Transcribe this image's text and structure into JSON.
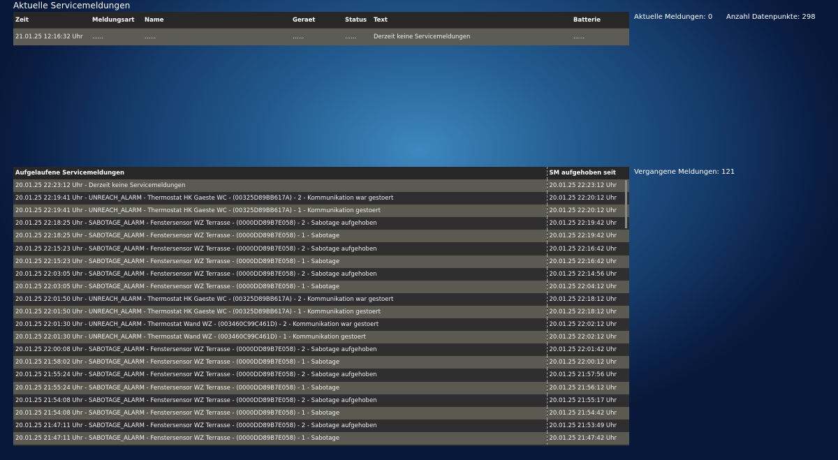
{
  "page_title": "Aktuelle Servicemeldungen",
  "current": {
    "headers": [
      "Zeit",
      "Meldungsart",
      "Name",
      "Geraet",
      "Status",
      "Text",
      "Batterie"
    ],
    "row": [
      "21.01.25 12:16:32 Uhr",
      "......",
      "......",
      "......",
      "......",
      "Derzeit keine Servicemeldungen",
      "......"
    ]
  },
  "info": {
    "current_count": "Aktuelle Meldungen: 0",
    "datapoints": "Anzahl Datenpunkte: 298",
    "past_count": "Vergangene Meldungen: 121"
  },
  "past": {
    "headers": [
      "Aufgelaufene Servicemeldungen",
      "SM aufgehoben seit"
    ],
    "rows": [
      [
        "20.01.25 22:23:12 Uhr - Derzeit keine Servicemeldungen",
        "20.01.25 22:23:12 Uhr"
      ],
      [
        "20.01.25 22:19:41 Uhr - UNREACH_ALARM - Thermostat HK Gaeste WC - (00325D89BB617A) - 2 - Kommunikation war gestoert",
        "20.01.25 22:20:12 Uhr"
      ],
      [
        "20.01.25 22:19:41 Uhr - UNREACH_ALARM - Thermostat HK Gaeste WC - (00325D89BB617A) - 1 - Kommunikation gestoert",
        "20.01.25 22:20:12 Uhr"
      ],
      [
        "20.01.25 22:18:25 Uhr - SABOTAGE_ALARM - Fenstersensor WZ Terrasse - (0000DD89B7E058) - 2 - Sabotage aufgehoben",
        "20.01.25 22:19:42 Uhr"
      ],
      [
        "20.01.25 22:18:25 Uhr - SABOTAGE_ALARM - Fenstersensor WZ Terrasse - (0000DD89B7E058) - 1 - Sabotage",
        "20.01.25 22:19:42 Uhr"
      ],
      [
        "20.01.25 22:15:23 Uhr - SABOTAGE_ALARM - Fenstersensor WZ Terrasse - (0000DD89B7E058) - 2 - Sabotage aufgehoben",
        "20.01.25 22:16:42 Uhr"
      ],
      [
        "20.01.25 22:15:23 Uhr - SABOTAGE_ALARM - Fenstersensor WZ Terrasse - (0000DD89B7E058) - 1 - Sabotage",
        "20.01.25 22:16:42 Uhr"
      ],
      [
        "20.01.25 22:03:05 Uhr - SABOTAGE_ALARM - Fenstersensor WZ Terrasse - (0000DD89B7E058) - 2 - Sabotage aufgehoben",
        "20.01.25 22:14:56 Uhr"
      ],
      [
        "20.01.25 22:03:05 Uhr - SABOTAGE_ALARM - Fenstersensor WZ Terrasse - (0000DD89B7E058) - 1 - Sabotage",
        "20.01.25 22:04:12 Uhr"
      ],
      [
        "20.01.25 22:01:50 Uhr - UNREACH_ALARM - Thermostat HK Gaeste WC - (00325D89BB617A) - 2 - Kommunikation war gestoert",
        "20.01.25 22:18:12 Uhr"
      ],
      [
        "20.01.25 22:01:50 Uhr - UNREACH_ALARM - Thermostat HK Gaeste WC - (00325D89BB617A) - 1 - Kommunikation gestoert",
        "20.01.25 22:18:12 Uhr"
      ],
      [
        "20.01.25 22:01:30 Uhr - UNREACH_ALARM - Thermostat Wand WZ - (003460C99C461D) - 2 - Kommunikation war gestoert",
        "20.01.25 22:02:12 Uhr"
      ],
      [
        "20.01.25 22:01:30 Uhr - UNREACH_ALARM - Thermostat Wand WZ - (003460C99C461D) - 1 - Kommunikation gestoert",
        "20.01.25 22:02:12 Uhr"
      ],
      [
        "20.01.25 22:00:08 Uhr - SABOTAGE_ALARM - Fenstersensor WZ Terrasse - (0000DD89B7E058) - 2 - Sabotage aufgehoben",
        "20.01.25 22:01:42 Uhr"
      ],
      [
        "20.01.25 21:58:02 Uhr - SABOTAGE_ALARM - Fenstersensor WZ Terrasse - (0000DD89B7E058) - 1 - Sabotage",
        "20.01.25 22:00:12 Uhr"
      ],
      [
        "20.01.25 21:55:24 Uhr - SABOTAGE_ALARM - Fenstersensor WZ Terrasse - (0000DD89B7E058) - 2 - Sabotage aufgehoben",
        "20.01.25 21:57:56 Uhr"
      ],
      [
        "20.01.25 21:55:24 Uhr - SABOTAGE_ALARM - Fenstersensor WZ Terrasse - (0000DD89B7E058) - 1 - Sabotage",
        "20.01.25 21:56:12 Uhr"
      ],
      [
        "20.01.25 21:54:08 Uhr - SABOTAGE_ALARM - Fenstersensor WZ Terrasse - (0000DD89B7E058) - 2 - Sabotage aufgehoben",
        "20.01.25 21:55:17 Uhr"
      ],
      [
        "20.01.25 21:54:08 Uhr - SABOTAGE_ALARM - Fenstersensor WZ Terrasse - (0000DD89B7E058) - 1 - Sabotage",
        "20.01.25 21:54:42 Uhr"
      ],
      [
        "20.01.25 21:47:11 Uhr - SABOTAGE_ALARM - Fenstersensor WZ Terrasse - (0000DD89B7E058) - 2 - Sabotage aufgehoben",
        "20.01.25 21:53:49 Uhr"
      ],
      [
        "20.01.25 21:47:11 Uhr - SABOTAGE_ALARM - Fenstersensor WZ Terrasse - (0000DD89B7E058) - 1 - Sabotage",
        "20.01.25 21:47:42 Uhr"
      ]
    ]
  }
}
